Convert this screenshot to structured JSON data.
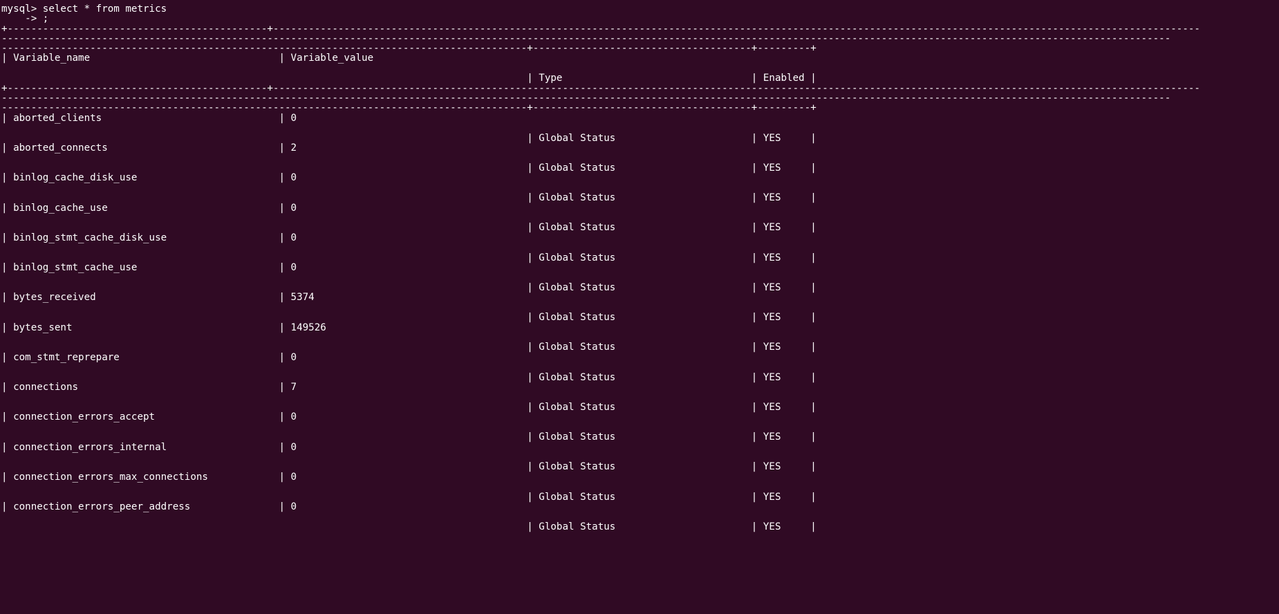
{
  "terminal": {
    "prompt_line": "mysql> select * from metrics",
    "continuation_line": "    -> ;",
    "border_top_1": "+--------------------------------------------+-------------------------------------------------------------------------------------------------------------------------------------------------------------",
    "border_top_2": "------------------------------------------------------------------------------------------------------------------------------------------------------------------------------------------------------",
    "border_top_3": "-----------------------------------------------------------------------------------------+-------------------------------------+---------+",
    "header_line_1": "| Variable_name                                | Variable_value",
    "header_line_2": "                                                                                         | Type                                | Enabled |",
    "border_mid_1": "+--------------------------------------------+-------------------------------------------------------------------------------------------------------------------------------------------------------------",
    "border_mid_2": "------------------------------------------------------------------------------------------------------------------------------------------------------------------------------------------------------",
    "border_mid_3": "-----------------------------------------------------------------------------------------+-------------------------------------+---------+",
    "rows": [
      {
        "name_value": "| aborted_clients                              | 0",
        "type_enabled": "                                                                                         | Global Status                       | YES     |"
      },
      {
        "name_value": "| aborted_connects                             | 2",
        "type_enabled": "                                                                                         | Global Status                       | YES     |"
      },
      {
        "name_value": "| binlog_cache_disk_use                        | 0",
        "type_enabled": "                                                                                         | Global Status                       | YES     |"
      },
      {
        "name_value": "| binlog_cache_use                             | 0",
        "type_enabled": "                                                                                         | Global Status                       | YES     |"
      },
      {
        "name_value": "| binlog_stmt_cache_disk_use                   | 0",
        "type_enabled": "                                                                                         | Global Status                       | YES     |"
      },
      {
        "name_value": "| binlog_stmt_cache_use                        | 0",
        "type_enabled": "                                                                                         | Global Status                       | YES     |"
      },
      {
        "name_value": "| bytes_received                               | 5374",
        "type_enabled": "                                                                                         | Global Status                       | YES     |"
      },
      {
        "name_value": "| bytes_sent                                   | 149526",
        "type_enabled": "                                                                                         | Global Status                       | YES     |"
      },
      {
        "name_value": "| com_stmt_reprepare                           | 0",
        "type_enabled": "                                                                                         | Global Status                       | YES     |"
      },
      {
        "name_value": "| connections                                  | 7",
        "type_enabled": "                                                                                         | Global Status                       | YES     |"
      },
      {
        "name_value": "| connection_errors_accept                     | 0",
        "type_enabled": "                                                                                         | Global Status                       | YES     |"
      },
      {
        "name_value": "| connection_errors_internal                   | 0",
        "type_enabled": "                                                                                         | Global Status                       | YES     |"
      },
      {
        "name_value": "| connection_errors_max_connections            | 0",
        "type_enabled": "                                                                                         | Global Status                       | YES     |"
      },
      {
        "name_value": "| connection_errors_peer_address               | 0",
        "type_enabled": "                                                                                         | Global Status                       | YES     |"
      }
    ]
  }
}
